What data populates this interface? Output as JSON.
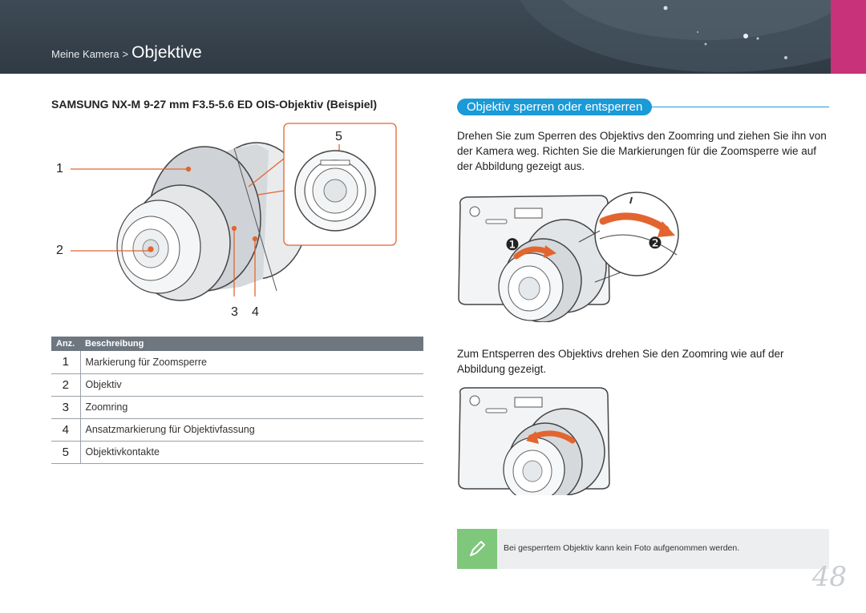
{
  "header": {
    "breadcrumb_parent": "Meine Kamera",
    "breadcrumb_separator": ">",
    "breadcrumb_current": "Objektive",
    "background_color": "#35414b",
    "accent_color": "#c7327a"
  },
  "lens_section": {
    "title": "SAMSUNG NX-M 9-27 mm F3.5-5.6 ED OIS-Objektiv (Beispiel)",
    "callouts": [
      "1",
      "2",
      "3",
      "4",
      "5"
    ]
  },
  "table": {
    "header_num": "Anz.",
    "header_desc": "Beschreibung",
    "rows": [
      {
        "num": "1",
        "desc": "Markierung für Zoomsperre"
      },
      {
        "num": "2",
        "desc": "Objektiv"
      },
      {
        "num": "3",
        "desc": "Zoomring"
      },
      {
        "num": "4",
        "desc": "Ansatzmarkierung für Objektivfassung"
      },
      {
        "num": "5",
        "desc": "Objektivkontakte"
      }
    ]
  },
  "lock_section": {
    "heading": "Objektiv sperren oder entsperren",
    "accent_color": "#1a9ad6",
    "paragraph1": "Drehen Sie zum Sperren des Objektivs den Zoomring und ziehen Sie ihn von der Kamera weg. Richten Sie die Markierungen für die Zoomsperre wie auf der Abbildung gezeigt aus.",
    "step_markers": [
      "❶",
      "❷"
    ],
    "paragraph2": "Zum Entsperren des Objektivs drehen Sie den Zoomring wie auf der Abbildung gezeigt."
  },
  "note": {
    "icon": "pencil-note-icon",
    "text": "Bei gesperrtem Objektiv kann kein Foto aufgenommen werden.",
    "icon_color": "#7fc77b"
  },
  "page_number": "48"
}
